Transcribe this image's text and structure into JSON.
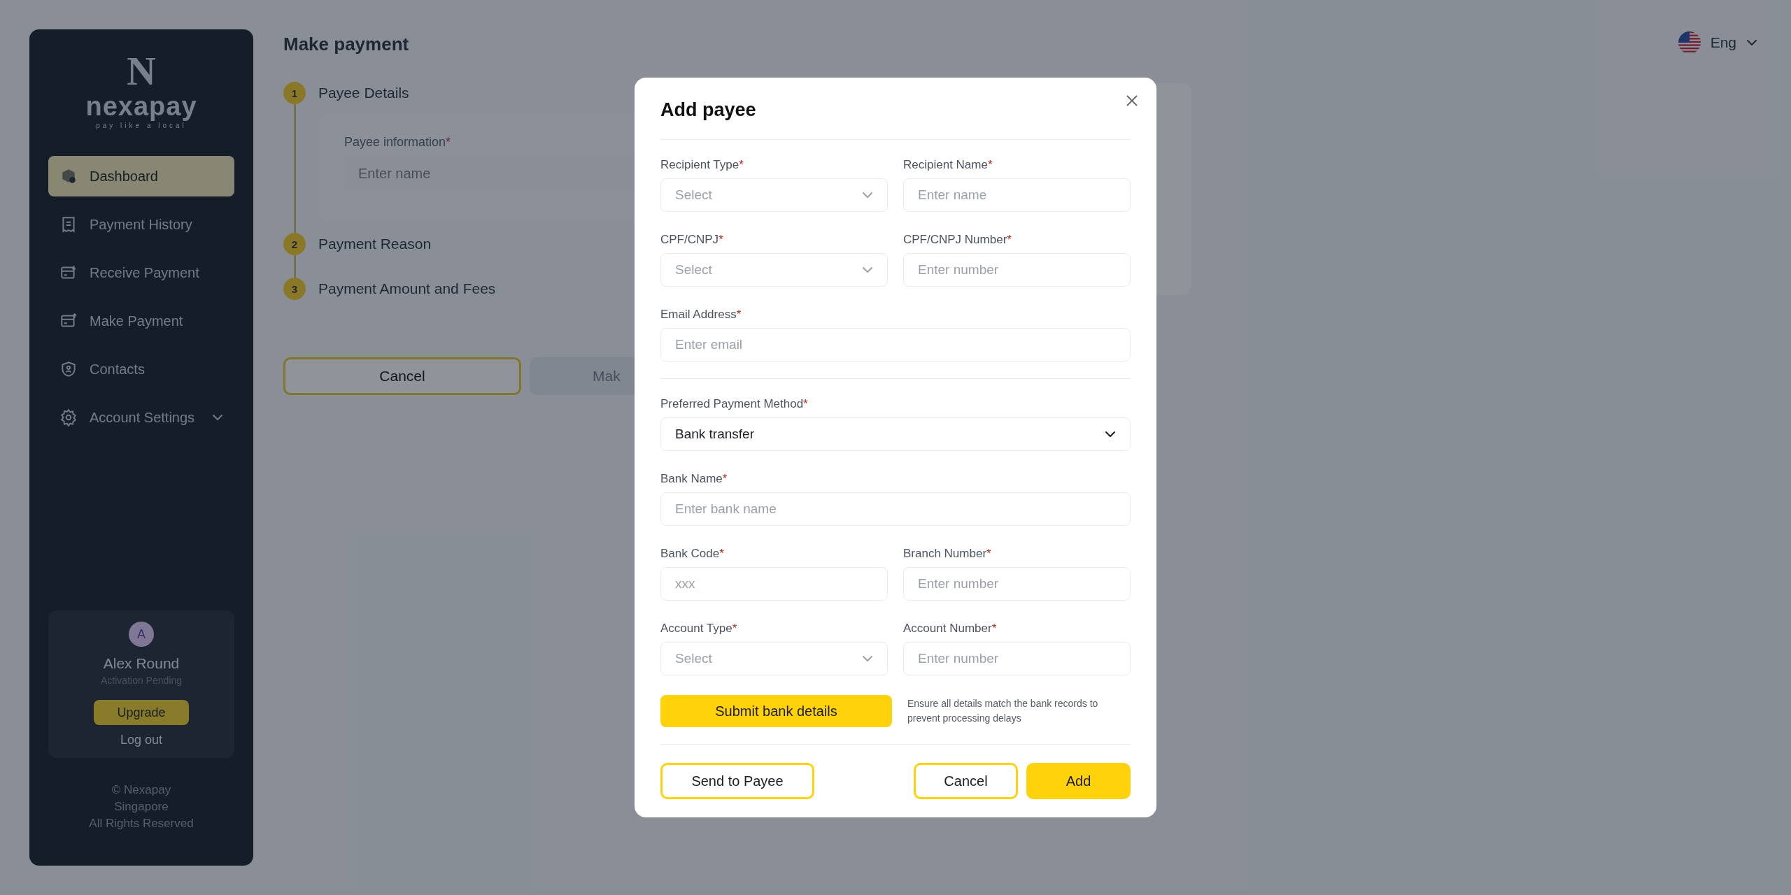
{
  "sidebar": {
    "logo_mark": "N",
    "logo_name": "nexapay",
    "tagline": "pay like a local",
    "nav": [
      {
        "label": "Dashboard",
        "selected": true
      },
      {
        "label": "Payment History",
        "selected": false
      },
      {
        "label": "Receive Payment",
        "selected": false
      },
      {
        "label": "Make Payment",
        "selected": false
      },
      {
        "label": "Contacts",
        "selected": false
      },
      {
        "label": "Account Settings",
        "selected": false,
        "expandable": true
      }
    ],
    "user": {
      "initial": "A",
      "name": "Alex Round",
      "status": "Activation Pending",
      "upgrade": "Upgrade",
      "logout": "Log out"
    },
    "footer": [
      "© Nexapay",
      "Singapore",
      "All Rights Reserved"
    ]
  },
  "language": "Eng",
  "page": {
    "title": "Make payment",
    "steps": [
      {
        "number": "1",
        "label": "Payee Details"
      },
      {
        "number": "2",
        "label": "Payment Reason"
      },
      {
        "number": "3",
        "label": "Payment Amount and Fees"
      }
    ],
    "payee_field": {
      "label": "Payee information",
      "marker": "*",
      "placeholder": "Enter name"
    },
    "cancel": "Cancel",
    "next": "Mak"
  },
  "modal": {
    "title": "Add payee",
    "sections": [
      {
        "rows": [
          [
            {
              "label": "Recipient Type",
              "marker": "*",
              "kind": "select",
              "placeholder": "Select"
            },
            {
              "label": "Recipient Name",
              "marker": "*",
              "kind": "input",
              "placeholder": "Enter name"
            }
          ],
          [
            {
              "label": "CPF/CNPJ",
              "marker": "*",
              "kind": "select",
              "placeholder": "Select"
            },
            {
              "label": "CPF/CNPJ Number",
              "marker": "*",
              "kind": "input",
              "placeholder": "Enter number"
            }
          ],
          [
            {
              "label": "Email Address",
              "marker": "*",
              "kind": "input",
              "placeholder": "Enter email"
            }
          ]
        ]
      },
      {
        "rows": [
          [
            {
              "label": "Preferred Payment Method",
              "marker": "*",
              "kind": "select",
              "value": "Bank transfer"
            }
          ],
          [
            {
              "label": "Bank Name",
              "marker": "*",
              "kind": "input",
              "placeholder": "Enter bank name"
            }
          ],
          [
            {
              "label": "Bank Code",
              "marker": "*",
              "kind": "input",
              "placeholder": "xxx"
            },
            {
              "label": "Branch Number",
              "marker": "*",
              "kind": "input",
              "placeholder": "Enter number"
            }
          ],
          [
            {
              "label": "Account Type",
              "marker": "*",
              "kind": "select",
              "placeholder": "Select"
            },
            {
              "label": "Account Number",
              "marker": "*",
              "kind": "input",
              "placeholder": "Enter number"
            }
          ]
        ],
        "submit": "Submit bank details",
        "note": "Ensure all details match the bank records to prevent processing delays"
      }
    ],
    "send": "Send to Payee",
    "cancel": "Cancel",
    "add": "Add"
  }
}
